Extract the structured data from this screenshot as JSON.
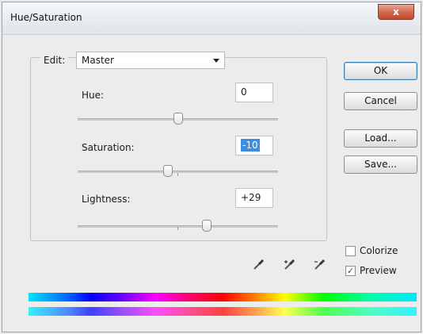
{
  "window": {
    "title": "Hue/Saturation",
    "close_label": "x"
  },
  "edit": {
    "label": "Edit:",
    "selected": "Master"
  },
  "sliders": {
    "hue": {
      "label": "Hue:",
      "value": "0",
      "level": 0
    },
    "saturation": {
      "label": "Saturation:",
      "value": "-10",
      "level": -10
    },
    "lightness": {
      "label": "Lightness:",
      "value": "+29",
      "level": 29
    }
  },
  "buttons": {
    "ok": "OK",
    "cancel": "Cancel",
    "load": "Load...",
    "save": "Save..."
  },
  "options": {
    "colorize": {
      "label": "Colorize",
      "checked": false
    },
    "preview": {
      "label": "Preview",
      "checked": true
    }
  },
  "icons": {
    "eyedroppers": [
      "eyedropper-icon",
      "eyedropper-plus-icon",
      "eyedropper-minus-icon"
    ]
  }
}
